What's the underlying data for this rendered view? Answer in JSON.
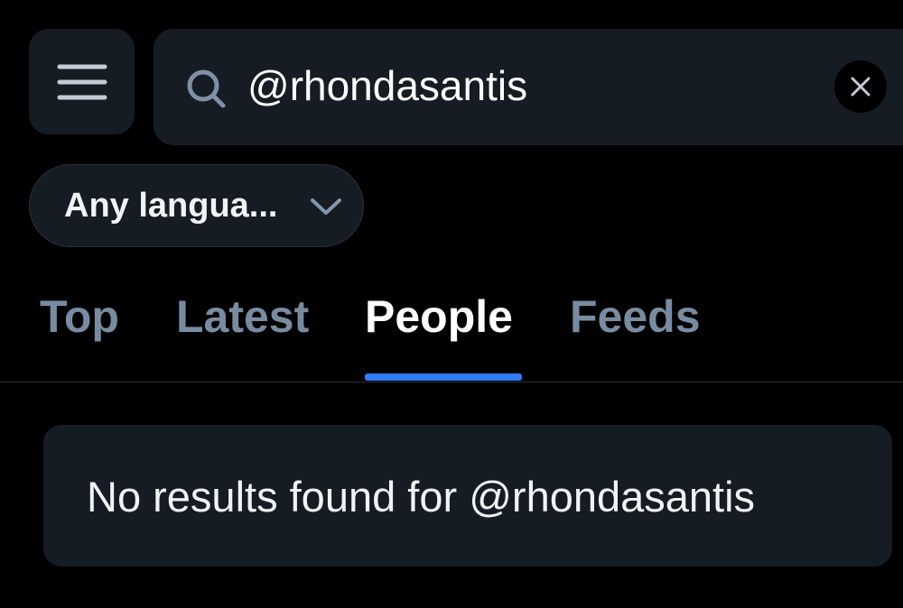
{
  "header": {
    "menu_icon": "hamburger-menu-icon",
    "search": {
      "icon": "search-icon",
      "value": "@rhondasantis",
      "placeholder": "",
      "clear_icon": "close-icon"
    }
  },
  "filters": {
    "language": {
      "label": "Any langua...",
      "icon": "chevron-down-icon"
    }
  },
  "tabs": [
    {
      "label": "Top",
      "active": false
    },
    {
      "label": "Latest",
      "active": false
    },
    {
      "label": "People",
      "active": true
    },
    {
      "label": "Feeds",
      "active": false
    }
  ],
  "results": {
    "empty_message": "No results found for @rhondasantis"
  },
  "colors": {
    "background": "#000000",
    "surface": "#161c24",
    "inactive_tab": "#788ca1",
    "accent": "#2e7cf6"
  }
}
